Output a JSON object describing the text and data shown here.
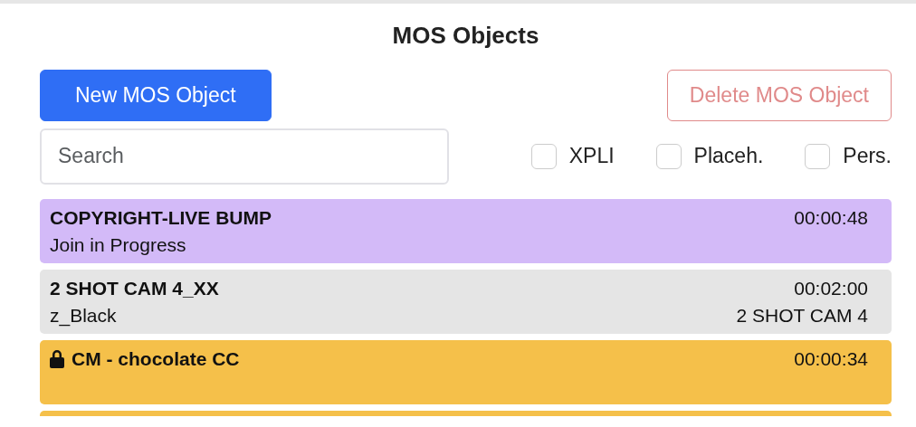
{
  "panel": {
    "title": "MOS Objects"
  },
  "buttons": {
    "new": "New MOS Object",
    "delete": "Delete MOS Object",
    "delete_disabled": true
  },
  "search": {
    "placeholder": "Search"
  },
  "filters": [
    {
      "label": "XPLI",
      "checked": false
    },
    {
      "label": "Placeh.",
      "checked": false
    },
    {
      "label": "Pers.",
      "checked": false
    }
  ],
  "objects": [
    {
      "title": "COPYRIGHT-LIVE BUMP",
      "duration": "00:00:48",
      "subtitle": "Join in Progress",
      "color": "#d3baf8",
      "locked": false
    },
    {
      "title": "2 SHOT CAM 4_XX",
      "duration": "00:02:00",
      "subtitle": "z_Black",
      "source": "2 SHOT CAM 4",
      "color": "#e5e5e5",
      "locked": false
    },
    {
      "title": "CM - chocolate CC",
      "duration": "00:00:34",
      "color": "#f5c04a",
      "locked": true
    },
    {
      "color": "#f5c04a",
      "locked": false
    }
  ]
}
